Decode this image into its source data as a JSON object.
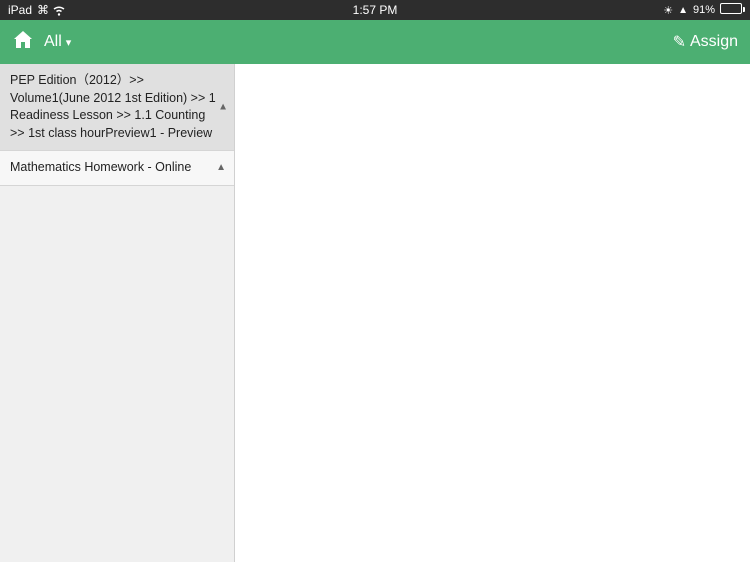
{
  "statusBar": {
    "device": "iPad",
    "wifi": "wifi",
    "time": "1:57 PM",
    "brightness_icon": "☀",
    "signal_icon": "⬆",
    "battery_percent": "91%"
  },
  "navBar": {
    "home_icon": "⌂",
    "all_label": "All",
    "chevron": "▾",
    "assign_label": "Assign",
    "pencil_icon": "✎"
  },
  "sidebar": {
    "items": [
      {
        "text": "PEP Edition（2012）>>\nVolume1(June 2012 1st Edition) >> 1\nReadiness Lesson >> 1.1 Counting\n>> 1st class hourPreview1 - Preview",
        "has_arrow": true
      },
      {
        "text": "Mathematics Homework - Online",
        "has_arrow": true
      }
    ]
  }
}
